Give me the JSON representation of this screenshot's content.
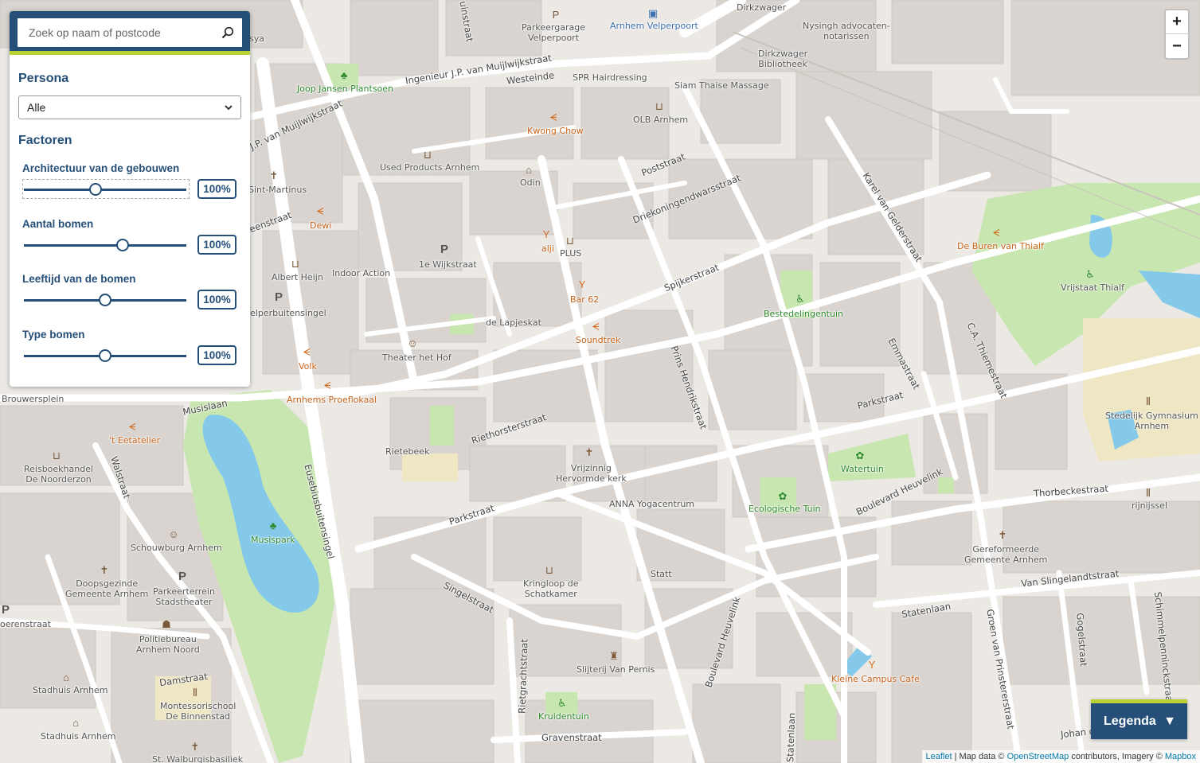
{
  "search": {
    "placeholder": "Zoek op naam of postcode",
    "icon": "search-icon"
  },
  "persona": {
    "title": "Persona",
    "selected": "Alle"
  },
  "factors": {
    "title": "Factoren",
    "items": [
      {
        "label": "Architectuur van de gebouwen",
        "value_label": "100%",
        "slider_level": 0.44
      },
      {
        "label": "Aantal bomen",
        "value_label": "100%",
        "slider_level": 0.61
      },
      {
        "label": "Leeftijd van de bomen",
        "value_label": "100%",
        "slider_level": 0.5
      },
      {
        "label": "Type bomen",
        "value_label": "100%",
        "slider_level": 0.5
      }
    ]
  },
  "zoom": {
    "in": "+",
    "out": "−"
  },
  "legend": {
    "label": "Legenda",
    "icon": "▼"
  },
  "attribution": {
    "leaflet": "Leaflet",
    "text1": " | Map data © ",
    "osm": "OpenStreetMap",
    "text2": " contributors, Imagery © ",
    "mapbox": "Mapbox"
  },
  "map": {
    "places": {
      "parkeergarage": "Parkeergarage\nVelperpoort",
      "station": "Arnhem Velperpoort",
      "dirkzwager": "Dirkzwager",
      "nysingh": "Nysingh advocaten-\nnotarissen",
      "dirkzwager_bib": "Dirkzwager\nBibliotheek",
      "joop": "Joop Jansen Plantsoen",
      "spr": "SPR Hairdressing",
      "siam": "Siam Thaise Massage",
      "kwong": "Kwong Chow",
      "olb": "OLB Arnhem",
      "used": "Used Products Arnhem",
      "odin": "Odin",
      "martinus": "Sint-Martinus",
      "dewi": "Dewi",
      "alji": "alji",
      "plus": "PLUS",
      "wijkstraat": "1e Wijkstraat",
      "albert": "Albert Heijn",
      "indoor": "Indoor Action",
      "bar62": "Bar 62",
      "velper": "elperbuitensingel",
      "lapjeskat": "de Lapjeskat",
      "soundtrek": "Soundtrek",
      "theater": "Theater het Hof",
      "volk": "Volk",
      "proeflokaal": "Arnhems Proeflokaal",
      "brouwersplein": "Brouwersplein",
      "buren": "De Buren van Thialf",
      "vrijstaat": "Vrijstaat Thialf",
      "bestede": "Bestedelingentuin",
      "eetatelier": "'t Eetatelier",
      "rietebeek": "Rietebeek",
      "reisboek": "Reisboekhandel\nDe Noorderzon",
      "vrijzinnig": "Vrijzinnig\nHervormde kerk",
      "waterpark": "Watertuin",
      "gymnasium": "Stedelijk Gymnasium\nArnhem",
      "musispark": "Musispark",
      "anna": "ANNA Yogacentrum",
      "ecologische": "Ecologische Tuin",
      "rijnijssel": "rijnijssel",
      "schouwburg": "Schouwburg Arnhem",
      "doopsgezinde": "Doopsgezinde\nGemeente Arnhem",
      "parkeerterrein": "Parkeerterrein\nStadstheater",
      "statt": "Statt",
      "kringloop": "Kringloop de\nSchatkamer",
      "gereformeerde": "Gereformeerde\nGemeente Arnhem",
      "politie": "Politiebureau\nArnhem Noord",
      "slijterij": "Slijterij Van Pernis",
      "kleine": "Kleine Campus Cafe",
      "stadhuis1": "Stadhuis Arnhem",
      "montessori": "Montessorischool\nDe Binnenstad",
      "kruidentuin": "Kruidentuin",
      "stadhuis2": "Stadhuis Arnhem",
      "walburgis": "St. Walburgisbasiliek",
      "nsya": "sya",
      "oerenstraat": "oerenstraat"
    },
    "streets": {
      "uinstraat": "uinstraat",
      "mujlwijk1": "Ingenieur J.P. van Muijlwijkstraat",
      "westeinde": "Westeinde",
      "mujlwijk2": "J.P. van Muijlwijkstraat",
      "poststraat": "Poststraat",
      "driekoningen": "Driekoningendwarsstraat",
      "karel": "Karel van Gelderstraat",
      "spijkerstraat": "Spijkerstraat",
      "eenstraat": "eenstraat",
      "emmastraat": "Emmastraat",
      "thieme": "C.A. Thiemestraat",
      "prins": "Prins Hendrikstraat",
      "parkstraat1": "Parkstraat",
      "riethorst": "Riethorsterstraat",
      "musislaan": "Musislaan",
      "eusebius": "Eusebiusbuitensingel",
      "walstraat": "Walstraat",
      "parkstraat2": "Parkstraat",
      "heuvelink1": "Boulevard Heuvelink",
      "thorbecke": "Thorbeckestraat",
      "singelstraat": "Singelstraat",
      "slingelandt": "Van Slingelandtstraat",
      "statenlaan": "Statenlaan",
      "heuvelink2": "Boulevard Heuvelink",
      "groen": "Groen van Prinstererstraat",
      "gogelstraat": "Gogelstraat",
      "schimmel": "Schimmelpenninckstraat",
      "damstraat": "Damstraat",
      "rietgracht": "Rietgrachtstraat",
      "gravenstraat": "Gravenstraat",
      "statenlaan2": "Statenlaan",
      "johan": "Johan d"
    }
  }
}
